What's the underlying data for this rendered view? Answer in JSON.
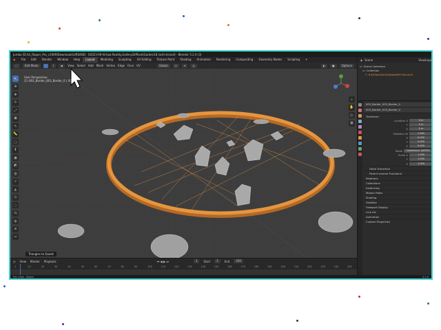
{
  "window": {
    "title": "Jumbo [D:\\Ui_Ripper_Pro_v1009\\Downloads\\UR6ADD - 02023-09-Virtual.Reality.Gallery.Difflock\\Garden18 (anti-strand] - Blender 5.2.0 (3)"
  },
  "menu": {
    "items": [
      "File",
      "Edit",
      "Render",
      "Window",
      "Help"
    ],
    "workspaces": [
      "Layout",
      "Modeling",
      "Sculpting",
      "UV Editing",
      "Texture Paint",
      "Shading",
      "Animation",
      "Rendering",
      "Compositing",
      "Geometry Nodes",
      "Scripting"
    ],
    "add_tab": "+"
  },
  "viewport_header": {
    "mode": "Edit Mode",
    "menus": [
      "View",
      "Select",
      "Add",
      "Mesh",
      "Vertex",
      "Edge",
      "Face",
      "UV"
    ],
    "transform": "Global",
    "options": "Options"
  },
  "viewport": {
    "perspective": "User Perspective",
    "object_info": "(1) 003_Border_003_Border_0 | (0)",
    "tooltip": "Triangles to Quads"
  },
  "timeline": {
    "menus": [
      "View",
      "Marker",
      "Playback"
    ],
    "current_frame": "1",
    "start_label": "Start",
    "start_value": "1",
    "end_label": "End",
    "end_value": "250",
    "ticks": [
      "1",
      "10",
      "20",
      "30",
      "40",
      "50",
      "60",
      "70",
      "80",
      "90",
      "100",
      "110",
      "120",
      "130",
      "140",
      "150",
      "160",
      "170",
      "180",
      "190",
      "200",
      "210",
      "220",
      "230",
      "240",
      "250"
    ]
  },
  "statusbar": {
    "left": "Pan View",
    "left2": "Select",
    "version": "5.2.0"
  },
  "scene": {
    "scene_name": "Scene",
    "view_layer": "ViewLayer"
  },
  "outliner": {
    "rows": [
      "Scene Collection",
      "Collection",
      "8.625ea1b5253b4ed090 Fence10"
    ]
  },
  "properties": {
    "object_name": "003_Border_003_Border_0",
    "mesh_name": "003_Border_003_Border_0",
    "transform_label": "Transform",
    "location_label": "Location X",
    "location": [
      "0 m",
      "0 m",
      "0 m"
    ],
    "rotation_label": "Rotation W",
    "rotation": [
      "1.000",
      "0.000",
      "0.000",
      "0.000"
    ],
    "mode_label": "Mode",
    "mode_value": "Quaternion (WXYZ)",
    "scale_label": "Scale X",
    "scale": [
      "1.000",
      "1.000",
      "1.000"
    ],
    "axis_y": "Y",
    "axis_z": "Z",
    "axis_x": "X",
    "sub_panels": [
      "Delta Transform",
      "Parent Inverse Transform"
    ],
    "panels": [
      "Relations",
      "Collections",
      "Instancing",
      "Motion Paths",
      "Shading",
      "Visibility",
      "Viewport Display",
      "Line Art",
      "Animation",
      "Custom Properties"
    ]
  },
  "colors": {
    "accent": "#4772b3",
    "frame": "#3fd2cf",
    "ring": "#e6953f"
  }
}
